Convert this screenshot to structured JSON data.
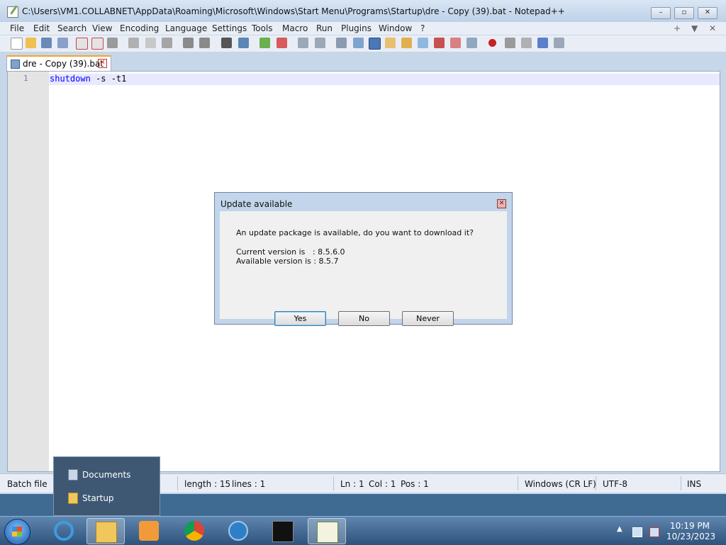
{
  "window": {
    "title": "C:\\Users\\VM1.COLLABNET\\AppData\\Roaming\\Microsoft\\Windows\\Start Menu\\Programs\\Startup\\dre - Copy (39).bat - Notepad++",
    "controls": {
      "minimize": "–",
      "maximize": "▫",
      "close": "✕"
    }
  },
  "menu": {
    "items": [
      "File",
      "Edit",
      "Search",
      "View",
      "Encoding",
      "Language",
      "Settings",
      "Tools",
      "Macro",
      "Run",
      "Plugins",
      "Window",
      "?"
    ],
    "right_controls": [
      "+",
      "▼",
      "✕"
    ]
  },
  "tab": {
    "label": "dre - Copy (39).bat",
    "close": "✕"
  },
  "editor": {
    "line_number": "1",
    "code_keyword": "shutdown",
    "code_rest": " -s -t1"
  },
  "status": {
    "filetype": "Batch file",
    "length": "length : 15",
    "lines": "lines : 1",
    "ln": "Ln : 1",
    "col": "Col : 1",
    "pos": "Pos : 1",
    "eol": "Windows (CR LF)",
    "encoding": "UTF-8",
    "mode": "INS"
  },
  "dialog": {
    "title": "Update available",
    "close": "✕",
    "message": "An update package is available, do you want to download it?",
    "current": "Current version is   : 8.5.6.0",
    "available": "Available version is : 8.5.7",
    "buttons": {
      "yes": "Yes",
      "no": "No",
      "never": "Never"
    }
  },
  "jumplist": {
    "items": [
      "Documents",
      "Startup"
    ]
  },
  "taskbar": {
    "icons": [
      "windows-start-icon",
      "internet-explorer-icon",
      "file-explorer-icon",
      "media-player-icon",
      "chrome-icon",
      "network-app-icon",
      "command-prompt-icon",
      "notepad-plus-plus-icon"
    ],
    "time": "10:19 PM",
    "date": "10/23/2023"
  },
  "colors": {
    "keyword": "#0000ff",
    "tab_accent": "#f5a623",
    "line_highlight": "#e8e8ff"
  }
}
